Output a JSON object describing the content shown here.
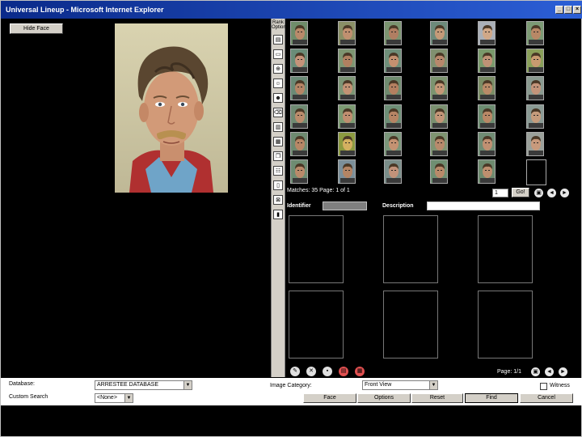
{
  "window": {
    "title": "Universal Lineup - Microsoft Internet Explorer",
    "controls": [
      "_",
      "□",
      "×"
    ]
  },
  "left": {
    "hide_button": "Hide Face"
  },
  "toolstrip": {
    "label": "Rank Options",
    "buttons": [
      {
        "icon": "list-icon",
        "glyph": "▤"
      },
      {
        "icon": "card-icon",
        "glyph": "▭"
      },
      {
        "icon": "zoom-icon",
        "glyph": "⊕"
      },
      {
        "icon": "faces-icon",
        "glyph": "☺"
      },
      {
        "icon": "faces-compare-icon",
        "glyph": "☻"
      },
      {
        "icon": "eraser-icon",
        "glyph": "⌫"
      },
      {
        "icon": "file-open-icon",
        "glyph": "▥"
      },
      {
        "icon": "save-icon",
        "glyph": "▦"
      },
      {
        "icon": "copy-icon",
        "glyph": "❐"
      },
      {
        "icon": "people-icon",
        "glyph": "☷"
      },
      {
        "icon": "page-icon",
        "glyph": "▯"
      },
      {
        "icon": "delete-icon",
        "glyph": "⊠"
      },
      {
        "icon": "trash-icon",
        "glyph": "▮"
      }
    ]
  },
  "gallery": {
    "matches_text": "Matches: 35 Page: 1 of 1",
    "page_value": "1",
    "go_label": "Go!",
    "thumbs": [
      {
        "tone": "#b98a6a",
        "bg": "#6f8c6a"
      },
      {
        "tone": "#c09070",
        "bg": "#8a8f66"
      },
      {
        "tone": "#b07e62",
        "bg": "#7b9470"
      },
      {
        "tone": "#c49a78",
        "bg": "#6d8a7a"
      },
      {
        "tone": "#d0a888",
        "bg": "#aab0b8"
      },
      {
        "tone": "#b88866",
        "bg": "#7c9a74"
      },
      {
        "tone": "#c5937a",
        "bg": "#6a8c78"
      },
      {
        "tone": "#b08060",
        "bg": "#7e9672"
      },
      {
        "tone": "#c49070",
        "bg": "#6f8f7a"
      },
      {
        "tone": "#b8886c",
        "bg": "#809070"
      },
      {
        "tone": "#bf9276",
        "bg": "#7a9a6c"
      },
      {
        "tone": "#c89a70",
        "bg": "#8aa05a"
      },
      {
        "tone": "#b58566",
        "bg": "#6a8a76"
      },
      {
        "tone": "#c29274",
        "bg": "#7d9676"
      },
      {
        "tone": "#b47f60",
        "bg": "#6f8b6f"
      },
      {
        "tone": "#c59878",
        "bg": "#7c9470"
      },
      {
        "tone": "#b98a68",
        "bg": "#7a8d66"
      },
      {
        "tone": "#c3947a",
        "bg": "#8a9a90"
      },
      {
        "tone": "#bb8c6c",
        "bg": "#6f8a72"
      },
      {
        "tone": "#c08e70",
        "bg": "#7c9a72"
      },
      {
        "tone": "#b68464",
        "bg": "#6d8e76"
      },
      {
        "tone": "#c39678",
        "bg": "#7a9070"
      },
      {
        "tone": "#b98866",
        "bg": "#6c8c70"
      },
      {
        "tone": "#c69c7c",
        "bg": "#8a9a94"
      },
      {
        "tone": "#b78766",
        "bg": "#6e8a70"
      },
      {
        "tone": "#d4b060",
        "bg": "#8c9a40"
      },
      {
        "tone": "#c49272",
        "bg": "#7a967a"
      },
      {
        "tone": "#b88a6c",
        "bg": "#7f9472"
      },
      {
        "tone": "#c09072",
        "bg": "#708c74"
      },
      {
        "tone": "#c89a7c",
        "bg": "#9aa09a"
      },
      {
        "tone": "#ba8a6a",
        "bg": "#6e8c72"
      },
      {
        "tone": "#b48464",
        "bg": "#7b8f9a"
      },
      {
        "tone": "#c2927a",
        "bg": "#7a8e8a"
      },
      {
        "tone": "#b98a6a",
        "bg": "#6f8f72"
      },
      {
        "tone": "#be8e6e",
        "bg": "#6d8a6e"
      }
    ],
    "empty_slots": 1,
    "nav_icons": [
      {
        "icon": "layout-icon",
        "glyph": "▣"
      },
      {
        "icon": "prev-icon",
        "glyph": "◄"
      },
      {
        "icon": "next-icon",
        "glyph": "►"
      }
    ]
  },
  "lineup": {
    "identifier_label": "Identifier",
    "identifier_value": "",
    "description_label": "Description",
    "description_value": "",
    "slots": 6,
    "tools": [
      {
        "icon": "edit-icon",
        "glyph": "✎"
      },
      {
        "icon": "remove-icon",
        "glyph": "✕"
      },
      {
        "icon": "save-lineup-icon",
        "glyph": "▪"
      },
      {
        "icon": "print-icon",
        "glyph": "▤"
      },
      {
        "icon": "print-red-icon",
        "glyph": "▦"
      }
    ],
    "page_text": "Page: 1/1",
    "page_nav": [
      {
        "icon": "lineup-layout-icon",
        "glyph": "▣"
      },
      {
        "icon": "lineup-prev-icon",
        "glyph": "◄"
      },
      {
        "icon": "lineup-next-icon",
        "glyph": "►"
      }
    ]
  },
  "form": {
    "database_label": "Database:",
    "database_value": "ARRESTEE DATABASE",
    "custom_search_label": "Custom Search",
    "custom_search_value": "<None>",
    "image_category_label": "Image Category:",
    "image_category_value": "Front View",
    "witness_label": "Witness",
    "buttons": {
      "face": "Face",
      "options": "Options",
      "reset": "Reset",
      "find": "Find",
      "cancel": "Cancel"
    }
  }
}
